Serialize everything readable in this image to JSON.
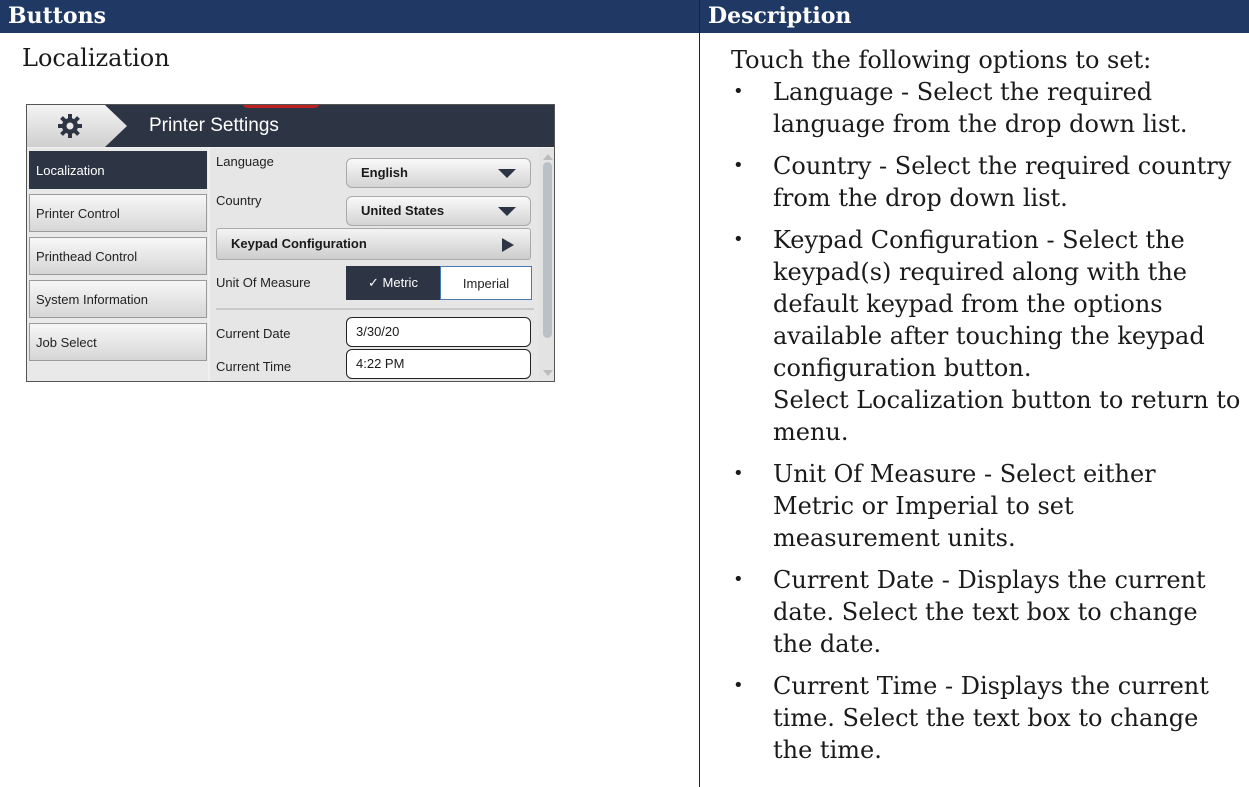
{
  "table": {
    "header_buttons": "Buttons",
    "header_description": "Description",
    "cell_title": "Localization"
  },
  "ui": {
    "title": "Printer Settings",
    "sidebar": [
      "Localization",
      "Printer Control",
      "Printhead Control",
      "System Information",
      "Job Select"
    ],
    "active_sidebar": "Localization",
    "language_label": "Language",
    "language_value": "English",
    "country_label": "Country",
    "country_value": "United States",
    "keypad_label": "Keypad Configuration",
    "unit_label": "Unit Of Measure",
    "unit_metric": "✓ Metric",
    "unit_imperial": "Imperial",
    "date_label": "Current Date",
    "date_value": "3/30/20",
    "time_label": "Current Time",
    "time_value": "4:22 PM",
    "colors": {
      "bar": "#2d3444",
      "header": "#1f3864"
    }
  },
  "description": {
    "intro": "Touch the following options to set:",
    "bullets": [
      {
        "text": "Language - Select the required language from the drop down list."
      },
      {
        "text": "Country - Select the required country from the drop down list."
      },
      {
        "text": "Keypad Configuration - Select the keypad(s) required along with the default keypad from the options available after touching the keypad configuration button.",
        "extra": "Select Localization button to return to menu."
      },
      {
        "text": "Unit Of Measure - Select either Metric or Imperial to set measurement units."
      },
      {
        "text": "Current Date - Displays the current date. Select the text box to change the date."
      },
      {
        "text": "Current Time - Displays the current time. Select the text box to change the time."
      }
    ]
  }
}
